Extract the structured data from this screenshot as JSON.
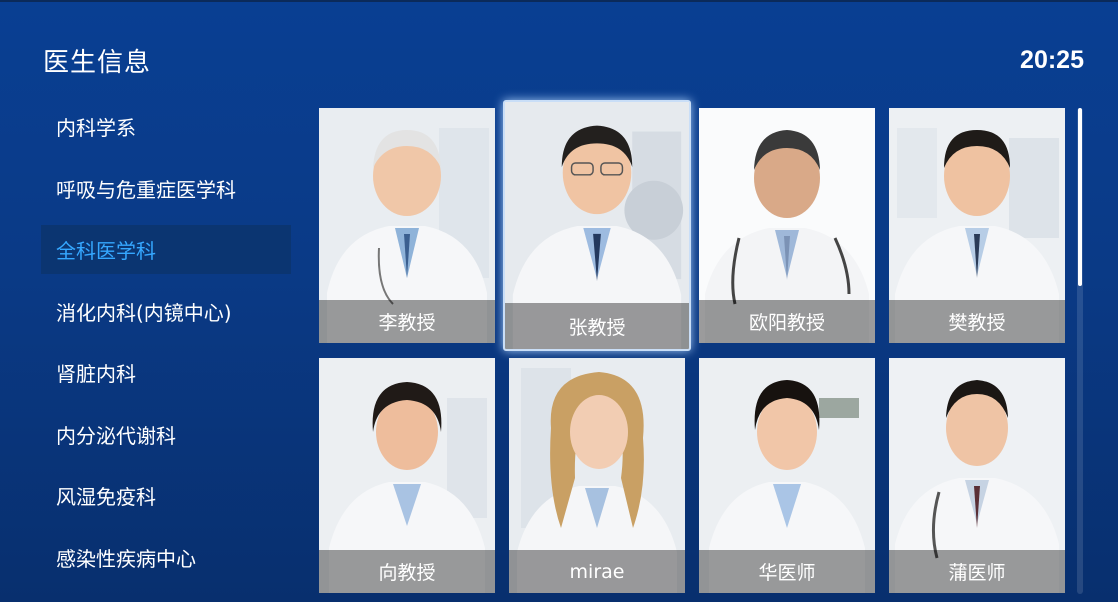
{
  "header": {
    "title": "医生信息",
    "time": "20:25"
  },
  "sidebar": {
    "items": [
      {
        "label": "内科学系",
        "active": false
      },
      {
        "label": "呼吸与危重症医学科",
        "active": false
      },
      {
        "label": "全科医学科",
        "active": true
      },
      {
        "label": "消化内科(内镜中心)",
        "active": false
      },
      {
        "label": "肾脏内科",
        "active": false
      },
      {
        "label": "内分泌代谢科",
        "active": false
      },
      {
        "label": "风湿免疫科",
        "active": false
      },
      {
        "label": "感染性疾病中心",
        "active": false
      }
    ]
  },
  "doctors": [
    {
      "name": "李教授",
      "focused": false
    },
    {
      "name": "张教授",
      "focused": true
    },
    {
      "name": "欧阳教授",
      "focused": false
    },
    {
      "name": "樊教授",
      "focused": false
    },
    {
      "name": "向教授",
      "focused": false
    },
    {
      "name": "mirae",
      "focused": false
    },
    {
      "name": "华医师",
      "focused": false
    },
    {
      "name": "蒲医师",
      "focused": false
    }
  ],
  "colors": {
    "background": "#093f93",
    "active_text": "#35a7ff",
    "active_bg": "#0b3571",
    "text": "#ffffff"
  }
}
